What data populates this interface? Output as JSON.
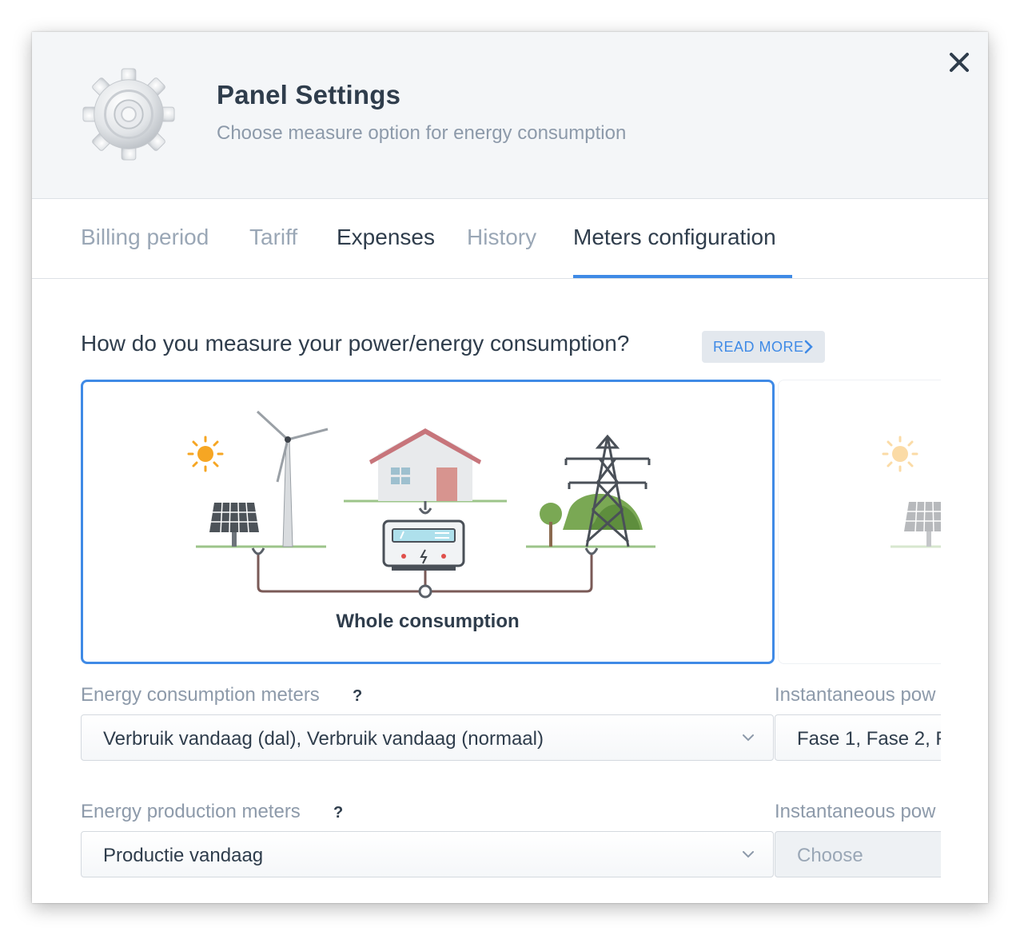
{
  "header": {
    "title": "Panel Settings",
    "subtitle": "Choose measure option for energy consumption",
    "icon": "gear-icon",
    "close_icon": "close-icon"
  },
  "tabs": [
    {
      "label": "Billing period",
      "active": false
    },
    {
      "label": "Tariff",
      "active": false
    },
    {
      "label": "Expenses",
      "active": false
    },
    {
      "label": "History",
      "active": false
    },
    {
      "label": "Meters configuration",
      "active": true
    }
  ],
  "question": {
    "text": "How do you measure your power/energy consumption?",
    "read_more": "READ MORE"
  },
  "options": [
    {
      "label": "Whole consumption",
      "selected": true
    },
    {
      "label": "",
      "selected": false
    }
  ],
  "fields": {
    "consumption": {
      "label": "Energy consumption meters",
      "help": "?",
      "value": "Verbruik vandaag (dal), Verbruik vandaag (normaal)"
    },
    "production": {
      "label": "Energy production meters",
      "help": "?",
      "value": "Productie vandaag"
    },
    "instant_consumption": {
      "label": "Instantaneous pow",
      "value": "Fase 1, Fase 2, Fa"
    },
    "instant_production": {
      "label": "Instantaneous pow",
      "placeholder": "Choose"
    }
  },
  "colors": {
    "accent": "#3f8ae6",
    "title": "#2f3d4c",
    "muted": "#8d9aaa",
    "header_bg": "#f4f6f8"
  }
}
